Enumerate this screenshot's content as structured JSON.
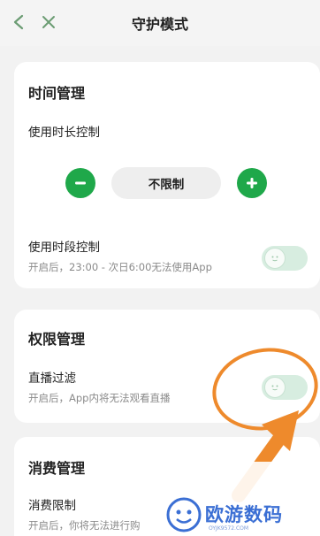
{
  "header": {
    "title": "守护模式"
  },
  "time_card": {
    "title": "时间管理",
    "duration_label": "使用时长控制",
    "duration_value": "不限制",
    "period_label": "使用时段控制",
    "period_desc": "开启后，23:00 - 次日6:00无法使用App"
  },
  "permission_card": {
    "title": "权限管理",
    "live_label": "直播过滤",
    "live_desc": "开启后，App内将无法观看直播"
  },
  "consume_card": {
    "title": "消费管理",
    "limit_label": "消费限制",
    "limit_desc": "开启后，你将无法进行购"
  },
  "watermark": {
    "text": "欧游数码",
    "sub": "OYJK9572.COM"
  },
  "colors": {
    "accent": "#1fa84a",
    "toggle_off": "#d7ede0",
    "highlight": "#ee8a2c"
  }
}
